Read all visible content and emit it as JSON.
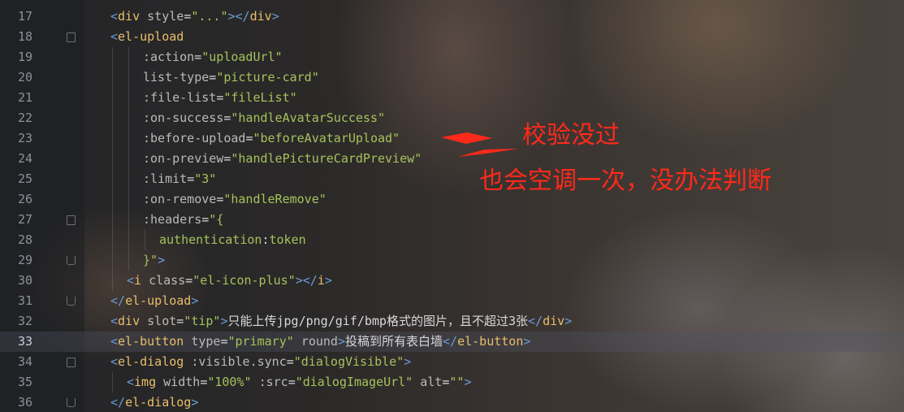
{
  "editor": {
    "current_line": 33,
    "lines": [
      {
        "num": "17",
        "indent": 0,
        "tokens": [
          [
            "br",
            "<"
          ],
          [
            "tg",
            "div"
          ],
          [
            "tx",
            " "
          ],
          [
            "an",
            "style"
          ],
          [
            "tx",
            "="
          ],
          [
            "st",
            "\"...\""
          ],
          [
            "br",
            "></"
          ],
          [
            "tg",
            "div"
          ],
          [
            "br",
            ">"
          ]
        ]
      },
      {
        "num": "18",
        "indent": 0,
        "fold": "start",
        "tokens": [
          [
            "br",
            "<"
          ],
          [
            "tg",
            "el-upload"
          ]
        ]
      },
      {
        "num": "19",
        "indent": 2,
        "tokens": [
          [
            "an",
            ":action"
          ],
          [
            "tx",
            "="
          ],
          [
            "st",
            "\"uploadUrl\""
          ]
        ]
      },
      {
        "num": "20",
        "indent": 2,
        "tokens": [
          [
            "an",
            "list-type"
          ],
          [
            "tx",
            "="
          ],
          [
            "st",
            "\"picture-card\""
          ]
        ]
      },
      {
        "num": "21",
        "indent": 2,
        "tokens": [
          [
            "an",
            ":file-list"
          ],
          [
            "tx",
            "="
          ],
          [
            "st",
            "\"fileList\""
          ]
        ]
      },
      {
        "num": "22",
        "indent": 2,
        "tokens": [
          [
            "an",
            ":on-success"
          ],
          [
            "tx",
            "="
          ],
          [
            "st",
            "\"handleAvatarSuccess\""
          ]
        ]
      },
      {
        "num": "23",
        "indent": 2,
        "tokens": [
          [
            "an",
            ":before-upload"
          ],
          [
            "tx",
            "="
          ],
          [
            "st",
            "\"beforeAvatarUpload\""
          ]
        ]
      },
      {
        "num": "24",
        "indent": 2,
        "tokens": [
          [
            "an",
            ":on-preview"
          ],
          [
            "tx",
            "="
          ],
          [
            "st",
            "\"handlePictureCardPreview\""
          ]
        ]
      },
      {
        "num": "25",
        "indent": 2,
        "tokens": [
          [
            "an",
            ":limit"
          ],
          [
            "tx",
            "="
          ],
          [
            "st",
            "\"3\""
          ]
        ]
      },
      {
        "num": "26",
        "indent": 2,
        "tokens": [
          [
            "an",
            ":on-remove"
          ],
          [
            "tx",
            "="
          ],
          [
            "st",
            "\"handleRemove\""
          ]
        ]
      },
      {
        "num": "27",
        "indent": 2,
        "fold": "start",
        "tokens": [
          [
            "an",
            ":headers"
          ],
          [
            "tx",
            "="
          ],
          [
            "st",
            "\"{"
          ]
        ]
      },
      {
        "num": "28",
        "indent": 3,
        "tokens": [
          [
            "st",
            "authentication"
          ],
          [
            "tx",
            ":"
          ],
          [
            "st",
            "token"
          ]
        ]
      },
      {
        "num": "29",
        "indent": 2,
        "fold": "end",
        "tokens": [
          [
            "st",
            "}\""
          ],
          [
            "br",
            ">"
          ]
        ]
      },
      {
        "num": "30",
        "indent": 1,
        "tokens": [
          [
            "br",
            "<"
          ],
          [
            "tg",
            "i"
          ],
          [
            "tx",
            " "
          ],
          [
            "an",
            "class"
          ],
          [
            "tx",
            "="
          ],
          [
            "st",
            "\"el-icon-plus\""
          ],
          [
            "br",
            "></"
          ],
          [
            "tg",
            "i"
          ],
          [
            "br",
            ">"
          ]
        ]
      },
      {
        "num": "31",
        "indent": 0,
        "fold": "end",
        "tokens": [
          [
            "br",
            "</"
          ],
          [
            "tg",
            "el-upload"
          ],
          [
            "br",
            ">"
          ]
        ]
      },
      {
        "num": "32",
        "indent": 0,
        "tokens": [
          [
            "br",
            "<"
          ],
          [
            "tg",
            "div"
          ],
          [
            "tx",
            " "
          ],
          [
            "an",
            "slot"
          ],
          [
            "tx",
            "="
          ],
          [
            "st",
            "\"tip\""
          ],
          [
            "br",
            ">"
          ],
          [
            "tx",
            "只能上传jpg/png/gif/bmp格式的图片，且不超过3张"
          ],
          [
            "br",
            "</"
          ],
          [
            "tg",
            "div"
          ],
          [
            "br",
            ">"
          ]
        ]
      },
      {
        "num": "33",
        "indent": 0,
        "tokens": [
          [
            "br",
            "<"
          ],
          [
            "tg",
            "el-button"
          ],
          [
            "tx",
            " "
          ],
          [
            "an",
            "type"
          ],
          [
            "tx",
            "="
          ],
          [
            "st",
            "\"primary\""
          ],
          [
            "tx",
            " "
          ],
          [
            "an",
            "round"
          ],
          [
            "br",
            ">"
          ],
          [
            "tx",
            "投稿到所有表白墙"
          ],
          [
            "br",
            "</"
          ],
          [
            "tg",
            "el-button"
          ],
          [
            "br",
            ">"
          ]
        ]
      },
      {
        "num": "34",
        "indent": 0,
        "fold": "start",
        "tokens": [
          [
            "br",
            "<"
          ],
          [
            "tg",
            "el-dialog"
          ],
          [
            "tx",
            " "
          ],
          [
            "an",
            ":visible.sync"
          ],
          [
            "tx",
            "="
          ],
          [
            "st",
            "\"dialogVisible\""
          ],
          [
            "br",
            ">"
          ]
        ]
      },
      {
        "num": "35",
        "indent": 1,
        "tokens": [
          [
            "br",
            "<"
          ],
          [
            "tg",
            "img"
          ],
          [
            "tx",
            " "
          ],
          [
            "an",
            "width"
          ],
          [
            "tx",
            "="
          ],
          [
            "st",
            "\"100%\""
          ],
          [
            "tx",
            " "
          ],
          [
            "an",
            ":src"
          ],
          [
            "tx",
            "="
          ],
          [
            "st",
            "\"dialogImageUrl\""
          ],
          [
            "tx",
            " "
          ],
          [
            "an",
            "alt"
          ],
          [
            "tx",
            "="
          ],
          [
            "st",
            "\"\""
          ],
          [
            "br",
            ">"
          ]
        ]
      },
      {
        "num": "36",
        "indent": 0,
        "fold": "end",
        "tokens": [
          [
            "br",
            "</"
          ],
          [
            "tg",
            "el-dialog"
          ],
          [
            "br",
            ">"
          ]
        ]
      }
    ]
  },
  "annotations": {
    "note1": "校验没过",
    "note2": "也会空调一次，没办法判断",
    "color": "#ff2a1a"
  }
}
